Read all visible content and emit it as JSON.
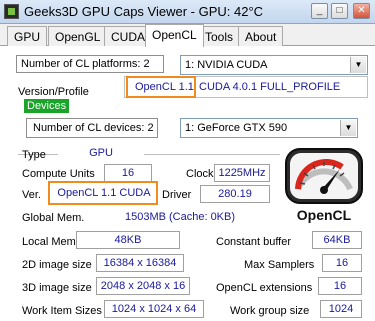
{
  "window": {
    "title": "Geeks3D GPU Caps Viewer - GPU: 42°C",
    "buttons": {
      "minimize": "_",
      "maximize": "□",
      "close": "✕"
    }
  },
  "tabs": [
    "GPU",
    "OpenGL",
    "CUDA",
    "OpenCL",
    "Tools",
    "About"
  ],
  "platforms": {
    "count_label": "Number of CL platforms: 2",
    "selected": "1: NVIDIA CUDA",
    "version_label": "Version/Profile",
    "version_highlight": "OpenCL 1.1",
    "version_rest": "CUDA 4.0.1 FULL_PROFILE"
  },
  "devices": {
    "legend": "Devices",
    "count_label": "Number of CL devices: 2",
    "selected": "1: GeForce GTX 590",
    "type_label": "Type",
    "type_value": "GPU",
    "compute_units_label": "Compute Units",
    "compute_units_value": "16",
    "clock_label": "Clock",
    "clock_value": "1225MHz",
    "ver_label": "Ver.",
    "ver_value": "OpenCL 1.1 CUDA",
    "driver_label": "Driver",
    "driver_value": "280.19",
    "global_mem_label": "Global Mem.",
    "global_mem_value": "1503MB (Cache: 0KB)",
    "local_mem_label": "Local Mem.",
    "local_mem_value": "48KB",
    "const_buffer_label": "Constant buffer",
    "const_buffer_value": "64KB",
    "img2d_label": "2D image size",
    "img2d_value": "16384 x 16384",
    "max_samplers_label": "Max Samplers",
    "max_samplers_value": "16",
    "img3d_label": "3D image size",
    "img3d_value": "2048 x 2048 x 16",
    "ext_label": "OpenCL extensions",
    "ext_value": "16",
    "work_item_label": "Work Item Sizes",
    "work_item_value": "1024 x 1024 x 64",
    "work_group_label": "Work group size",
    "work_group_value": "1024"
  },
  "logo": {
    "text": "OpenCL",
    "icon": "opencl-gauge-icon",
    "accent": "#d9261c"
  },
  "colors": {
    "highlight": "#f08c1e",
    "devices_legend": "#1aa52a",
    "value_text": "#1a1a9c"
  }
}
